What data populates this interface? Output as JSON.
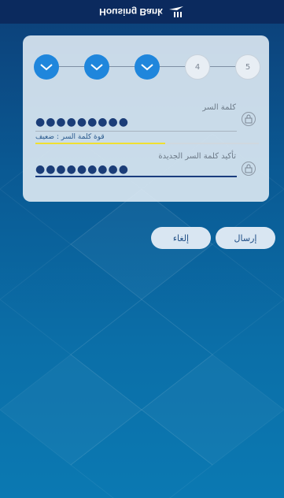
{
  "header": {
    "brand_name": "Housing Bank",
    "logo_icon": "housing-bank-logo-icon"
  },
  "colors": {
    "header_bg": "#0b2a5e",
    "step_done": "#1f86dc",
    "strength_bar": "#f0e030",
    "active_underline": "#1a3c7e",
    "button_bg": "#d9e6f2"
  },
  "stepper": {
    "steps": [
      {
        "label": "",
        "state": "done",
        "icon": "check-icon"
      },
      {
        "label": "",
        "state": "done",
        "icon": "check-icon"
      },
      {
        "label": "",
        "state": "done",
        "icon": "check-icon"
      },
      {
        "label": "4",
        "state": "todo"
      },
      {
        "label": "5",
        "state": "todo"
      }
    ]
  },
  "form": {
    "password": {
      "label": "كلمة السر",
      "value": "●●●●●●●●●",
      "icon": "password-icon"
    },
    "strength": {
      "label": "قوة كلمة السر : ضعيف",
      "level": 0.58
    },
    "confirm": {
      "label": "تأكيد كلمة السر الجديدة",
      "value": "●●●●●●●●●",
      "icon": "password-icon"
    }
  },
  "buttons": {
    "submit": "إرسال",
    "cancel": "إلغاء"
  }
}
